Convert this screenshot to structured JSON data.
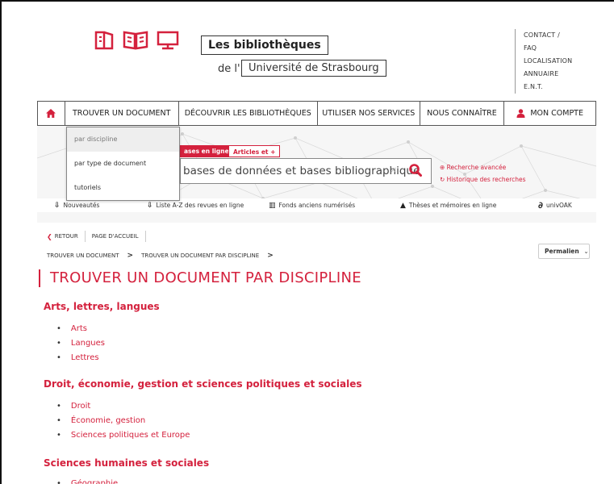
{
  "header": {
    "logo_line1": "Les bibliothèques",
    "logo_de": "de l'",
    "logo_line2": "Université de Strasbourg",
    "top_links": [
      "CONTACT /",
      "FAQ",
      "LOCALISATION",
      "ANNUAIRE",
      "E.N.T."
    ]
  },
  "nav": {
    "items": [
      {
        "label": "TROUVER UN DOCUMENT"
      },
      {
        "label": "DÉCOUVRIR LES BIBLIOTHÈQUES"
      },
      {
        "label": "UTILISER NOS SERVICES"
      },
      {
        "label": "NOUS CONNAÎTRE"
      },
      {
        "label": "MON COMPTE"
      }
    ],
    "dropdown": [
      "par discipline",
      "par type de document",
      "tutoriels"
    ]
  },
  "search": {
    "tab1": "ases en ligne",
    "tab2": "Articles et +",
    "value": "bases de données et bases bibliographique",
    "clear": "×",
    "advanced": "Recherche avancée",
    "history": "Historique des recherches"
  },
  "quick_links": [
    "Nouveautés",
    "Liste A-Z des revues en ligne",
    "Fonds anciens numérisés",
    "Thèses et mémoires en ligne",
    "univOAK"
  ],
  "breadcrumb": {
    "back": "RETOUR",
    "home": "PAGE D'ACCUEIL",
    "path": [
      "TROUVER UN DOCUMENT",
      "TROUVER UN DOCUMENT PAR DISCIPLINE"
    ],
    "permalink": "Permalien"
  },
  "page_title": "TROUVER UN DOCUMENT PAR DISCIPLINE",
  "sections": [
    {
      "title": "Arts, lettres, langues",
      "items": [
        "Arts",
        "Langues",
        "Lettres"
      ]
    },
    {
      "title": "Droit, économie, gestion et sciences politiques et sociales",
      "items": [
        "Droit",
        "Économie, gestion",
        "Sciences politiques et Europe"
      ]
    },
    {
      "title": "Sciences humaines et sociales",
      "items": [
        "Géographie"
      ]
    }
  ],
  "colors": {
    "accent": "#d4213d"
  }
}
